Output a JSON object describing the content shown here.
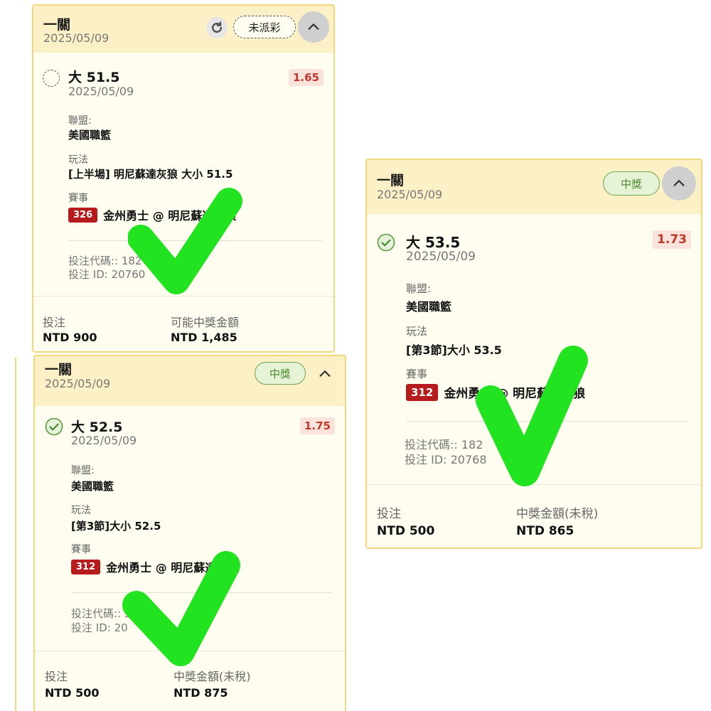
{
  "cards": [
    {
      "header_title": "一關",
      "header_date": "2025/05/09",
      "status": "未派彩",
      "selection": "大 51.5",
      "selection_date": "2025/05/09",
      "odds": "1.65",
      "league_label": "聯盟:",
      "league": "美國職籃",
      "market_label": "玩法",
      "market": "[上半場] 明尼蘇達灰狼 大小 51.5",
      "event_label": "賽事",
      "event_number": "326",
      "event_name": "金州勇士 @ 明尼蘇達灰狼",
      "bet_code_line": "投注代碼:: 182",
      "bet_id_line": "投注 ID: 20760",
      "stake_label": "投注",
      "stake": "NTD 900",
      "payout_label": "可能中獎金額",
      "payout": "NTD 1,485"
    },
    {
      "header_title": "一關",
      "header_date": "2025/05/09",
      "status": "中獎",
      "selection": "大 52.5",
      "selection_date": "2025/05/09",
      "odds": "1.75",
      "league_label": "聯盟:",
      "league": "美國職籃",
      "market_label": "玩法",
      "market": "[第3節]大小 52.5",
      "event_label": "賽事",
      "event_number": "312",
      "event_name": "金州勇士 @ 明尼蘇達灰狼",
      "bet_code_line": "投注代碼:: 54",
      "bet_id_line": "投注 ID: 20",
      "stake_label": "投注",
      "stake": "NTD 500",
      "payout_label": "中獎金額(未稅)",
      "payout": "NTD 875"
    },
    {
      "header_title": "一關",
      "header_date": "2025/05/09",
      "status": "中獎",
      "selection": "大 53.5",
      "selection_date": "2025/05/09",
      "odds": "1.73",
      "league_label": "聯盟:",
      "league": "美國職籃",
      "market_label": "玩法",
      "market": "[第3節]大小 53.5",
      "event_label": "賽事",
      "event_number": "312",
      "event_name": "金州勇士 @ 明尼蘇達灰狼",
      "bet_code_line": "投注代碼:: 182",
      "bet_id_line": "投注 ID: 20768",
      "stake_label": "投注",
      "stake": "NTD 500",
      "payout_label": "中獎金額(未稅)",
      "payout": "NTD 865"
    }
  ],
  "icons": {
    "refresh": "refresh-icon",
    "collapse": "chevron-up-icon",
    "pending": "dashed-circle-icon",
    "win": "check-circle-icon",
    "overlay": "green-checkmark-icon"
  },
  "colors": {
    "card_bg": "#fffcf0",
    "header_bg": "#fcf1c6",
    "border": "#f4d77c",
    "odds": "#c0392b",
    "event_badge": "#b71c1c",
    "win": "#4b8a2f",
    "overlay_check": "#22e31f"
  }
}
